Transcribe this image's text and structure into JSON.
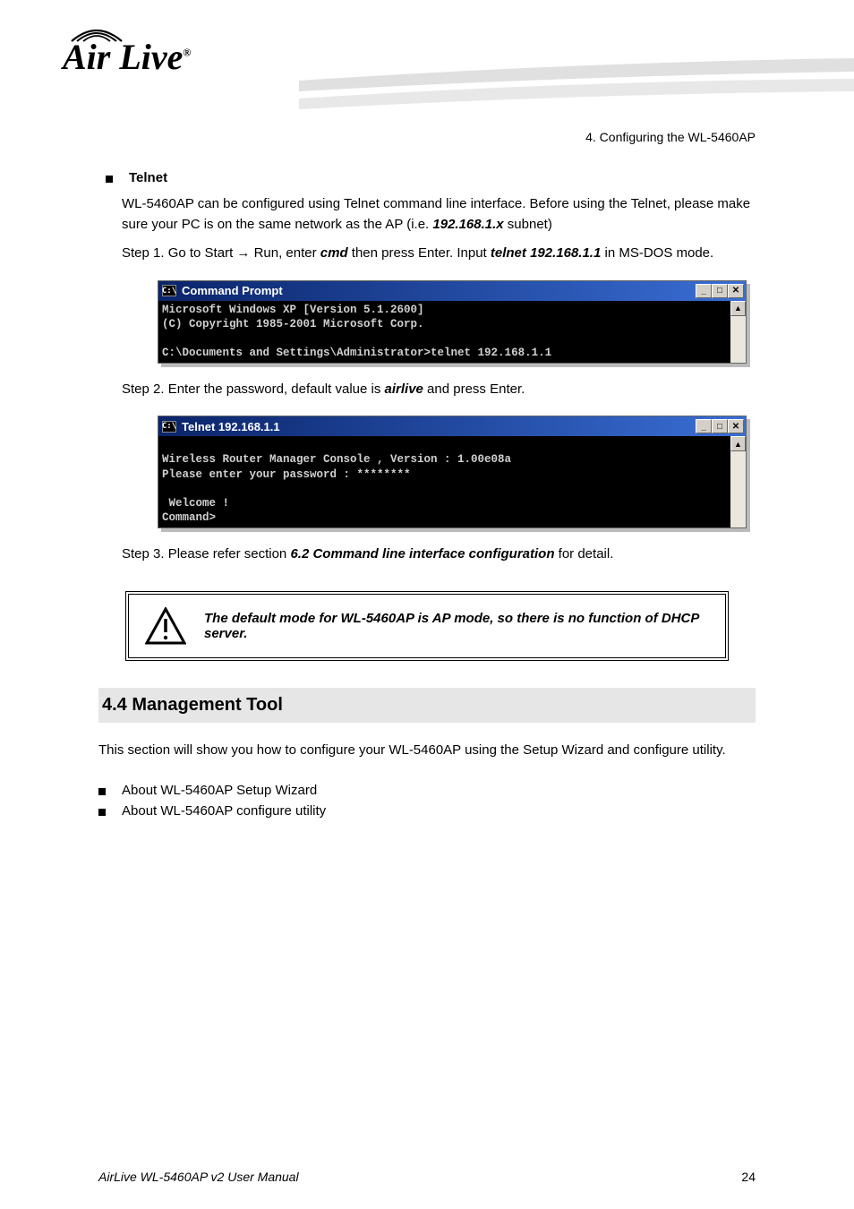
{
  "chapter_header": "4. Configuring the WL-5460AP",
  "logo_text": "Air Live",
  "bullet_telnet": "Telnet",
  "telnet_intro_pre": "WL-5460AP can be configured using Telnet command line interface. Before using the Telnet, please make sure your PC is on the same network as the AP (i.e. ",
  "telnet_intro_ip": "192.168.1.x",
  "telnet_intro_post": " subnet)",
  "step1_pre": "Step 1. Go to Start → Run, enter ",
  "step1_cmd": "cmd",
  "step1_mid": " then press Enter. Input ",
  "step1_telnet": "telnet 192.168.1.1",
  "step1_post": " in MS-DOS mode.",
  "cmd1": {
    "title": "Command Prompt",
    "icon_text": "C:\\",
    "lines": "Microsoft Windows XP [Version 5.1.2600]\n(C) Copyright 1985-2001 Microsoft Corp.\n\nC:\\Documents and Settings\\Administrator>telnet 192.168.1.1"
  },
  "step2_pre": "Step 2. Enter the password, default value is ",
  "step2_pw": "airlive",
  "step2_post": " and press Enter.",
  "cmd2": {
    "title": "Telnet 192.168.1.1",
    "icon_text": "C:\\",
    "lines": "\nWireless Router Manager Console , Version : 1.00e08a\nPlease enter your password : ********\n\n Welcome !\nCommand>"
  },
  "step3_pre": "Step 3. Please refer section ",
  "step3_link": "6.2 Command line interface configuration",
  "step3_post": " for detail.",
  "warning_text": "The default mode for WL-5460AP is AP mode, so there is no function of DHCP server.",
  "section_title": "4.4 Management Tool",
  "mgmt_intro": "This section will show you how to configure your WL-5460AP using the Setup Wizard and configure utility.",
  "bullet_wizard": "About WL-5460AP Setup Wizard",
  "bullet_config": "About WL-5460AP configure utility",
  "footer_left": "AirLive WL-5460AP v2 User Manual",
  "footer_right": "24"
}
